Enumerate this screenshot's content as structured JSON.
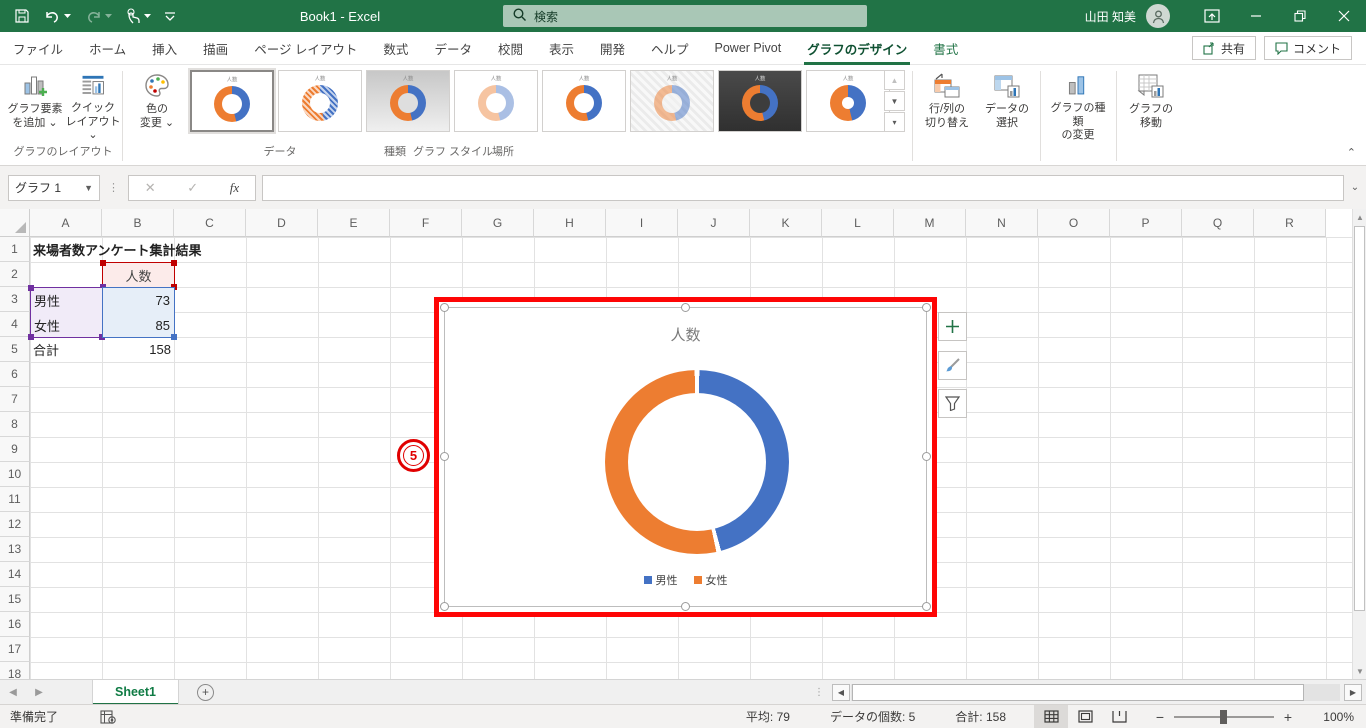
{
  "titlebar": {
    "title": "Book1  -  Excel",
    "search_placeholder": "検索",
    "user_name": "山田 知美"
  },
  "tabs": {
    "items": [
      "ファイル",
      "ホーム",
      "挿入",
      "描画",
      "ページ レイアウト",
      "数式",
      "データ",
      "校閲",
      "表示",
      "開発",
      "ヘルプ",
      "Power Pivot"
    ],
    "contextual": {
      "design": "グラフのデザイン",
      "format": "書式"
    },
    "share": "共有",
    "comment": "コメント"
  },
  "ribbon": {
    "add_element": "グラフ要素\nを追加 ⌄",
    "quick_layout": "クイック\nレイアウト ⌄",
    "layout_group": "グラフのレイアウト",
    "change_colors": "色の\n変更 ⌄",
    "styles_group": "グラフ スタイル",
    "style_items": [
      {
        "variant": "standard",
        "selected": true
      },
      {
        "variant": "hatched",
        "selected": false
      },
      {
        "variant": "gray-labels",
        "selected": false
      },
      {
        "variant": "pale",
        "selected": false
      },
      {
        "variant": "standard",
        "selected": false
      },
      {
        "variant": "light-hatch",
        "selected": false
      },
      {
        "variant": "dark",
        "selected": false
      },
      {
        "variant": "chunky",
        "selected": false
      }
    ],
    "switch_rowcol": "行/列の\n切り替え",
    "select_data": "データの\n選択",
    "data_group": "データ",
    "change_type": "グラフの種類\nの変更",
    "type_group": "種類",
    "move_chart": "グラフの\n移動",
    "location_group": "場所"
  },
  "formula_bar": {
    "name_box": "グラフ 1",
    "fx_label": "fx"
  },
  "grid": {
    "columns": [
      "A",
      "B",
      "C",
      "D",
      "E",
      "F",
      "G",
      "H",
      "I",
      "J",
      "K",
      "L",
      "M",
      "N",
      "O",
      "P",
      "Q",
      "R"
    ],
    "row_count": 18,
    "cells": {
      "a1": "来場者数アンケート集計結果",
      "b2": "人数",
      "a3": "男性",
      "b3": "73",
      "a4": "女性",
      "b4": "85",
      "a5": "合計",
      "b5": "158"
    }
  },
  "chart_data": {
    "type": "pie",
    "subtype": "doughnut",
    "title": "人数",
    "categories": [
      "男性",
      "女性"
    ],
    "values": [
      73,
      85
    ],
    "total": 158,
    "colors": [
      "#4472C4",
      "#ED7D31"
    ],
    "legend_position": "bottom"
  },
  "annotation": {
    "step_number": "5"
  },
  "sheet_bar": {
    "sheet_name": "Sheet1"
  },
  "status_bar": {
    "mode": "準備完了",
    "average": "平均: 79",
    "count": "データの個数: 5",
    "sum": "合計: 158",
    "zoom_level": "100%"
  }
}
